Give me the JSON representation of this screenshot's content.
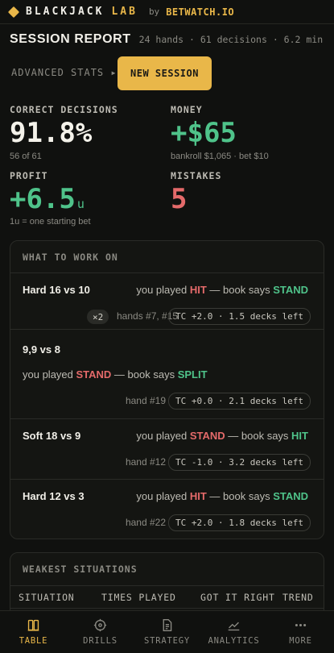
{
  "header": {
    "brand": "BLACKJACK",
    "brand_accent": "LAB",
    "by": "by",
    "partner": "BETWATCH.IO",
    "logo_icon": "diamond-icon"
  },
  "session": {
    "title": "SESSION REPORT",
    "meta": "24 hands · 61 decisions · 6.2 min",
    "advanced_stats": "ADVANCED STATS ▸",
    "new_session": "NEW SESSION"
  },
  "stats": {
    "correct": {
      "label": "CORRECT DECISIONS",
      "value": "91.8%",
      "sub": "56 of 61"
    },
    "money": {
      "label": "MONEY",
      "value": "+$65",
      "sub": "bankroll $1,065 · bet $10"
    },
    "profit": {
      "label": "PROFIT",
      "value": "+6.5",
      "unit": "u",
      "sub": "1u = one starting bet"
    },
    "mistakes": {
      "label": "MISTAKES",
      "value": "5"
    }
  },
  "work_on": {
    "title": "WHAT TO WORK ON",
    "items": [
      {
        "situation": "Hard 16 vs 10",
        "prefix": "you played ",
        "played": "HIT",
        "mid": " — book says ",
        "book": "STAND",
        "count": "×2",
        "hands": "hands #7, #15",
        "tc": "TC +2.0 · 1.5 decks left"
      },
      {
        "situation": "9,9 vs 8",
        "prefix": "you played ",
        "played": "STAND",
        "mid": " — book says ",
        "book": "SPLIT",
        "hands": "hand #19",
        "tc": "TC +0.0 · 2.1 decks left"
      },
      {
        "situation": "Soft 18 vs 9",
        "prefix": "you played ",
        "played": "STAND",
        "mid": " — book says ",
        "book": "HIT",
        "hands": "hand #12",
        "tc": "TC -1.0 · 3.2 decks left"
      },
      {
        "situation": "Hard 12 vs 3",
        "prefix": "you played ",
        "played": "HIT",
        "mid": " — book says ",
        "book": "STAND",
        "hands": "hand #22",
        "tc": "TC +2.0 · 1.8 decks left"
      }
    ]
  },
  "weakest": {
    "title": "WEAKEST SITUATIONS",
    "columns": [
      "SITUATION",
      "TIMES PLAYED",
      "GOT IT RIGHT",
      "TREND"
    ]
  },
  "nav": [
    {
      "label": "TABLE",
      "icon": "table-icon",
      "active": true
    },
    {
      "label": "DRILLS",
      "icon": "target-icon",
      "active": false
    },
    {
      "label": "STRATEGY",
      "icon": "document-icon",
      "active": false
    },
    {
      "label": "ANALYTICS",
      "icon": "chart-icon",
      "active": false
    },
    {
      "label": "MORE",
      "icon": "more-icon",
      "active": false
    }
  ],
  "colors": {
    "accent": "#e9b749",
    "green": "#4fc38a",
    "red": "#e46a6a",
    "background": "#10110f"
  }
}
